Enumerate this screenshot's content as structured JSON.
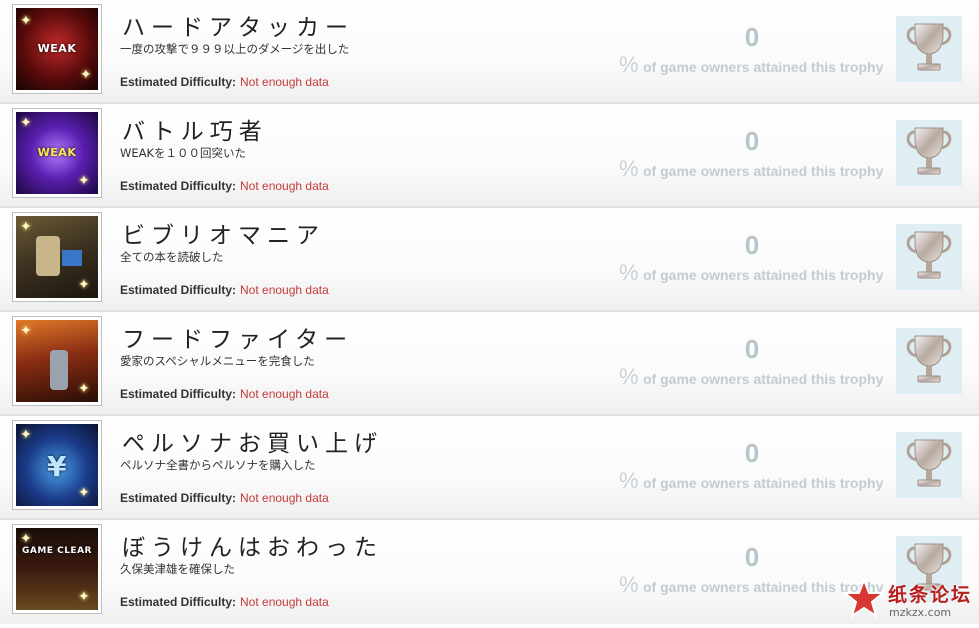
{
  "trophies": [
    {
      "title": "ハードアタッカー",
      "description": "一度の攻撃で９９９以上のダメージを出した",
      "difficulty_label": "Estimated Difficulty:",
      "difficulty_value": "Not enough data",
      "percent_value": "0",
      "percent_sign": "%",
      "percent_text": "of game owners attained this trophy",
      "badge_text": "WEAK",
      "trophy_type": "silver-trophy-icon"
    },
    {
      "title": "バトル巧者",
      "description": "WEAKを１００回突いた",
      "difficulty_label": "Estimated Difficulty:",
      "difficulty_value": "Not enough data",
      "percent_value": "0",
      "percent_sign": "%",
      "percent_text": "of game owners attained this trophy",
      "badge_text": "WEAK",
      "trophy_type": "silver-trophy-icon"
    },
    {
      "title": "ビブリオマニア",
      "description": "全ての本を読破した",
      "difficulty_label": "Estimated Difficulty:",
      "difficulty_value": "Not enough data",
      "percent_value": "0",
      "percent_sign": "%",
      "percent_text": "of game owners attained this trophy",
      "badge_text": "",
      "trophy_type": "silver-trophy-icon"
    },
    {
      "title": "フードファイター",
      "description": "愛家のスペシャルメニューを完食した",
      "difficulty_label": "Estimated Difficulty:",
      "difficulty_value": "Not enough data",
      "percent_value": "0",
      "percent_sign": "%",
      "percent_text": "of game owners attained this trophy",
      "badge_text": "",
      "trophy_type": "silver-trophy-icon"
    },
    {
      "title": "ペルソナお買い上げ",
      "description": "ペルソナ全書からペルソナを購入した",
      "difficulty_label": "Estimated Difficulty:",
      "difficulty_value": "Not enough data",
      "percent_value": "0",
      "percent_sign": "%",
      "percent_text": "of game owners attained this trophy",
      "badge_text": "¥",
      "trophy_type": "silver-trophy-icon"
    },
    {
      "title": "ぼうけんはおわった",
      "description": "久保美津雄を確保した",
      "difficulty_label": "Estimated Difficulty:",
      "difficulty_value": "Not enough data",
      "percent_value": "0",
      "percent_sign": "%",
      "percent_text": "of game owners attained this trophy",
      "badge_text": "GAME CLEAR",
      "trophy_type": "silver-trophy-icon"
    }
  ],
  "watermark": {
    "text": "纸条论坛",
    "url": "mzkzx.com"
  },
  "colors": {
    "difficulty_value": "#c83a3a",
    "percent": "#b8c4cc",
    "trophy_bg": "#dfeef2"
  }
}
